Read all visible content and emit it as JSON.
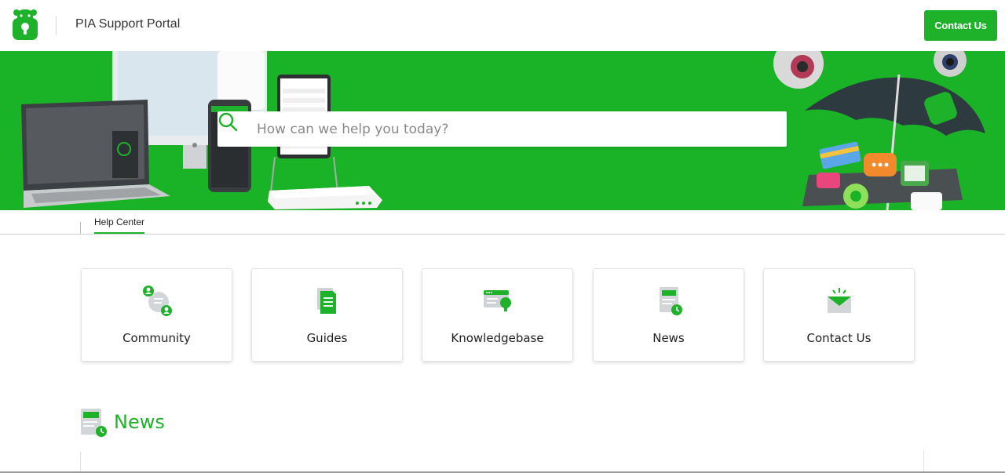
{
  "header": {
    "portal_title": "PIA Support Portal",
    "contact_label": "Contact Us"
  },
  "hero": {
    "search_placeholder": "How can we help you today?"
  },
  "subnav": {
    "tabs": [
      {
        "label": "Help Center",
        "active": true
      }
    ]
  },
  "cards": [
    {
      "label": "Community",
      "icon": "community-icon"
    },
    {
      "label": "Guides",
      "icon": "guides-icon"
    },
    {
      "label": "Knowledgebase",
      "icon": "knowledgebase-icon"
    },
    {
      "label": "News",
      "icon": "news-icon"
    },
    {
      "label": "Contact Us",
      "icon": "contact-envelope-icon"
    }
  ],
  "news_section": {
    "heading": "News",
    "icon": "news-icon"
  },
  "colors": {
    "brand_green": "#1eb22b",
    "hero_green": "#1ab226"
  }
}
